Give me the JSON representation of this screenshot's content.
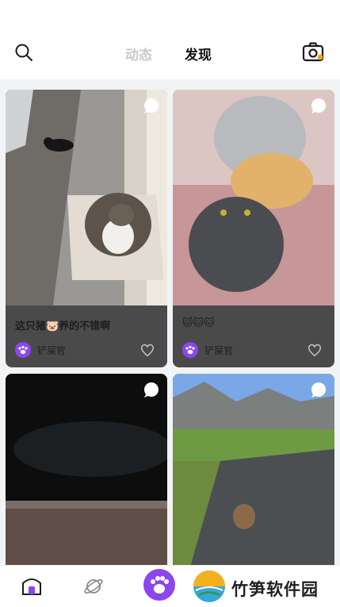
{
  "header": {
    "tabs": [
      {
        "label": "动态",
        "active": false
      },
      {
        "label": "发现",
        "active": true
      }
    ],
    "search_icon": "search-icon",
    "camera_icon": "camera-icon"
  },
  "feed": {
    "posts": [
      {
        "caption": "这只猪🐷养的不错啊",
        "author": "铲屎官",
        "image": "cats-on-balcony-photo",
        "liked": false
      },
      {
        "caption": "🐱🐱🐱",
        "author": "铲屎官",
        "image": "stacked-cats-photo",
        "liked": false
      },
      {
        "caption": "",
        "author": "",
        "image": "dark-cave-video",
        "liked": false
      },
      {
        "caption": "",
        "author": "",
        "image": "marmots-on-mountain-road-photo",
        "liked": false
      }
    ]
  },
  "bottom_nav": {
    "items": [
      "home-icon",
      "planet-icon",
      "paw-icon"
    ]
  },
  "watermark": {
    "text": "竹笋软件园"
  },
  "colors": {
    "accent": "#8b46f0",
    "card_bg": "#4a4a4a",
    "feed_bg": "#f2f3f5"
  }
}
